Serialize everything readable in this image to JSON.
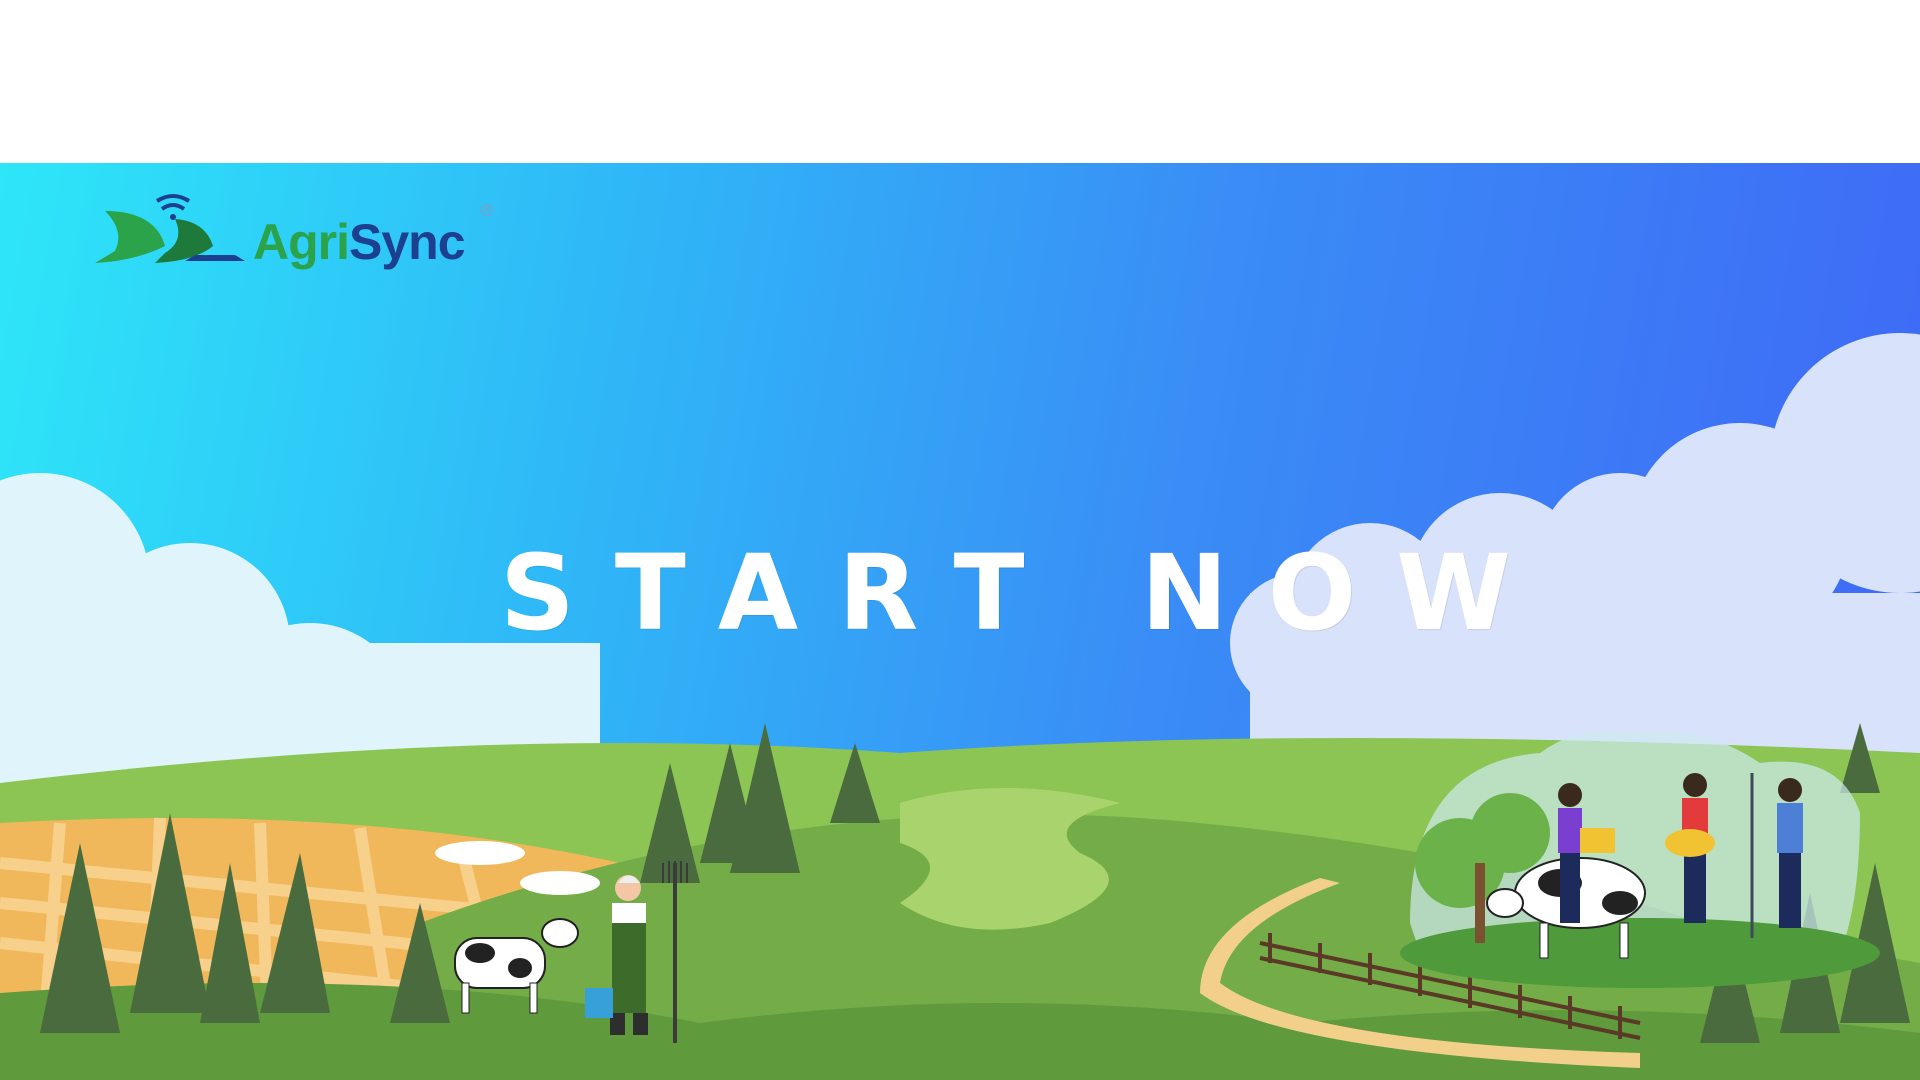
{
  "brand": {
    "name_part1": "Agri",
    "name_part2": "Sync",
    "registered_mark": "®",
    "icon": "leaf-wifi-icon",
    "colors": {
      "green": "#2aa34a",
      "navy": "#1d3f8f"
    }
  },
  "hero": {
    "cta_label": "START NOW",
    "sky_gradient": [
      "#2ee6f8",
      "#3f66f6"
    ]
  },
  "illustration": {
    "elements": [
      "farmer-with-pitchfork",
      "cow",
      "trees",
      "wheat-field",
      "clouds",
      "fence",
      "greenhouse-dome",
      "group-of-farmers"
    ]
  }
}
